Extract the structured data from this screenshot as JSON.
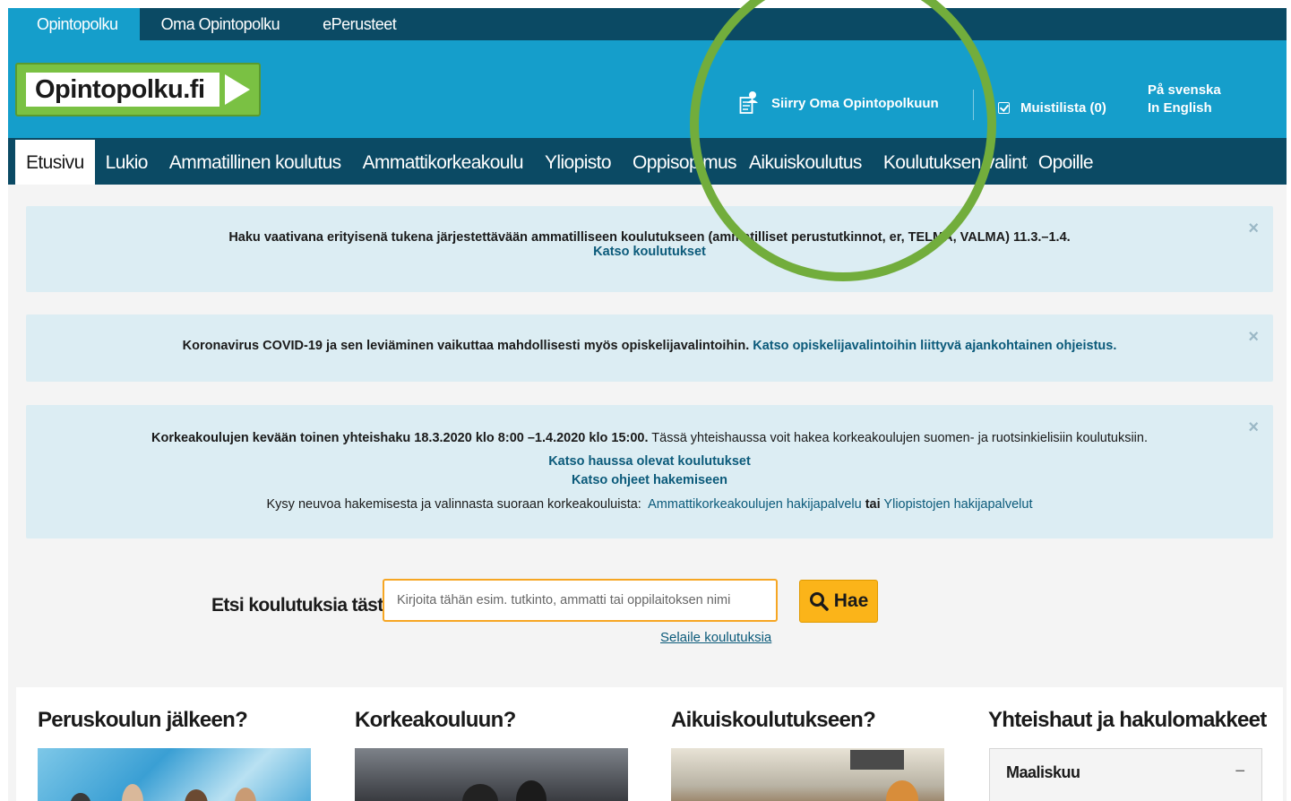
{
  "topbar": {
    "tabs": [
      {
        "label": "Opintopolku",
        "active": true
      },
      {
        "label": "Oma Opintopolku",
        "active": false
      },
      {
        "label": "ePerusteet",
        "active": false
      }
    ]
  },
  "header": {
    "logo_text": "Opintopolku.fi",
    "oma_link": "Siirry Oma Opintopolkuun",
    "muistilista": "Muistilista (0)",
    "lang_sv": "På svenska",
    "lang_en": "In English"
  },
  "mainnav": {
    "items": [
      {
        "label": "Etusivu",
        "active": true
      },
      {
        "label": "Lukio"
      },
      {
        "label": "Ammatillinen koulutus"
      },
      {
        "label": "Ammattikorkeakoulu"
      },
      {
        "label": "Yliopisto"
      },
      {
        "label": "Oppisopimus"
      },
      {
        "label": "Aikuiskoulutus"
      },
      {
        "label": "Koulutuksen valinta"
      },
      {
        "label": "Opoille"
      }
    ]
  },
  "notices": {
    "n1": {
      "text": "Haku vaativana erityisenä tukena järjestettävään ammatilliseen koulutukseen (ammatilliset perustutkinnot, er, TELMA, VALMA) 11.3.–1.4.",
      "link": "Katso koulutukset"
    },
    "n2": {
      "text": "Koronavirus COVID-19 ja sen leviäminen vaikuttaa mahdollisesti myös opiskelijavalintoihin.",
      "link": "Katso opiskelijavalintoihin liittyvä ajankohtainen ohjeistus."
    },
    "n3": {
      "bold_text": "Korkeakoulujen kevään toinen yhteishaku 18.3.2020 klo 8:00 –1.4.2020 klo 15:00.",
      "text": "Tässä yhteishaussa voit hakea korkeakoulujen suomen- ja ruotsinkielisiin koulutuksiin.",
      "link1": "Katso haussa olevat koulutukset",
      "link2": "Katso ohjeet hakemiseen",
      "ask": "Kysy neuvoa hakemisesta ja valinnasta suoraan korkeakouluista:",
      "amk_link": "Ammattikorkeakoulujen hakijapalvelu",
      "or": "tai",
      "yo_link": "Yliopistojen hakijapalvelut"
    },
    "close": "×"
  },
  "search": {
    "label": "Etsi koulutuksia tästä",
    "placeholder": "Kirjoita tähän esim. tutkinto, ammatti tai oppilaitoksen nimi",
    "button": "Hae",
    "browse": "Selaile koulutuksia"
  },
  "content": {
    "col1_title": "Peruskoulun jälkeen?",
    "col2_title": "Korkeakouluun?",
    "col3_title": "Aikuiskoulutukseen?",
    "col4_title": "Yhteishaut ja hakulomakkeet",
    "accordion_label": "Maaliskuu",
    "accordion_toggle": "−"
  },
  "colors": {
    "header_blue": "#159ecb",
    "nav_dark": "#0b4a64",
    "notice_bg": "#dcedf3",
    "search_orange": "#fbb419",
    "logo_green": "#7ac143",
    "highlight_ring": "#72ad3c"
  }
}
